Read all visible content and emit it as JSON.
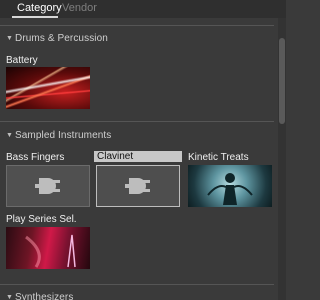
{
  "tabs": [
    {
      "label": "Category"
    },
    {
      "label": "Vendor"
    }
  ],
  "sections": [
    {
      "title": "Drums & Percussion",
      "items": [
        {
          "label": "Battery",
          "thumb": "battery-image"
        }
      ]
    },
    {
      "title": "Sampled Instruments",
      "items": [
        {
          "label": "Bass Fingers",
          "thumb": "plug-icon"
        },
        {
          "label": "Clavinet",
          "thumb": "plug-icon",
          "selected": true
        },
        {
          "label": "Kinetic Treats",
          "thumb": "kinetic-treats-image"
        },
        {
          "label": "Play Series Sel.",
          "thumb": "play-series-image"
        }
      ]
    },
    {
      "title": "Synthesizers",
      "items": []
    }
  ],
  "colors": {
    "background": "#3a3a3a",
    "selected_label_bg": "#c8c8c8"
  }
}
